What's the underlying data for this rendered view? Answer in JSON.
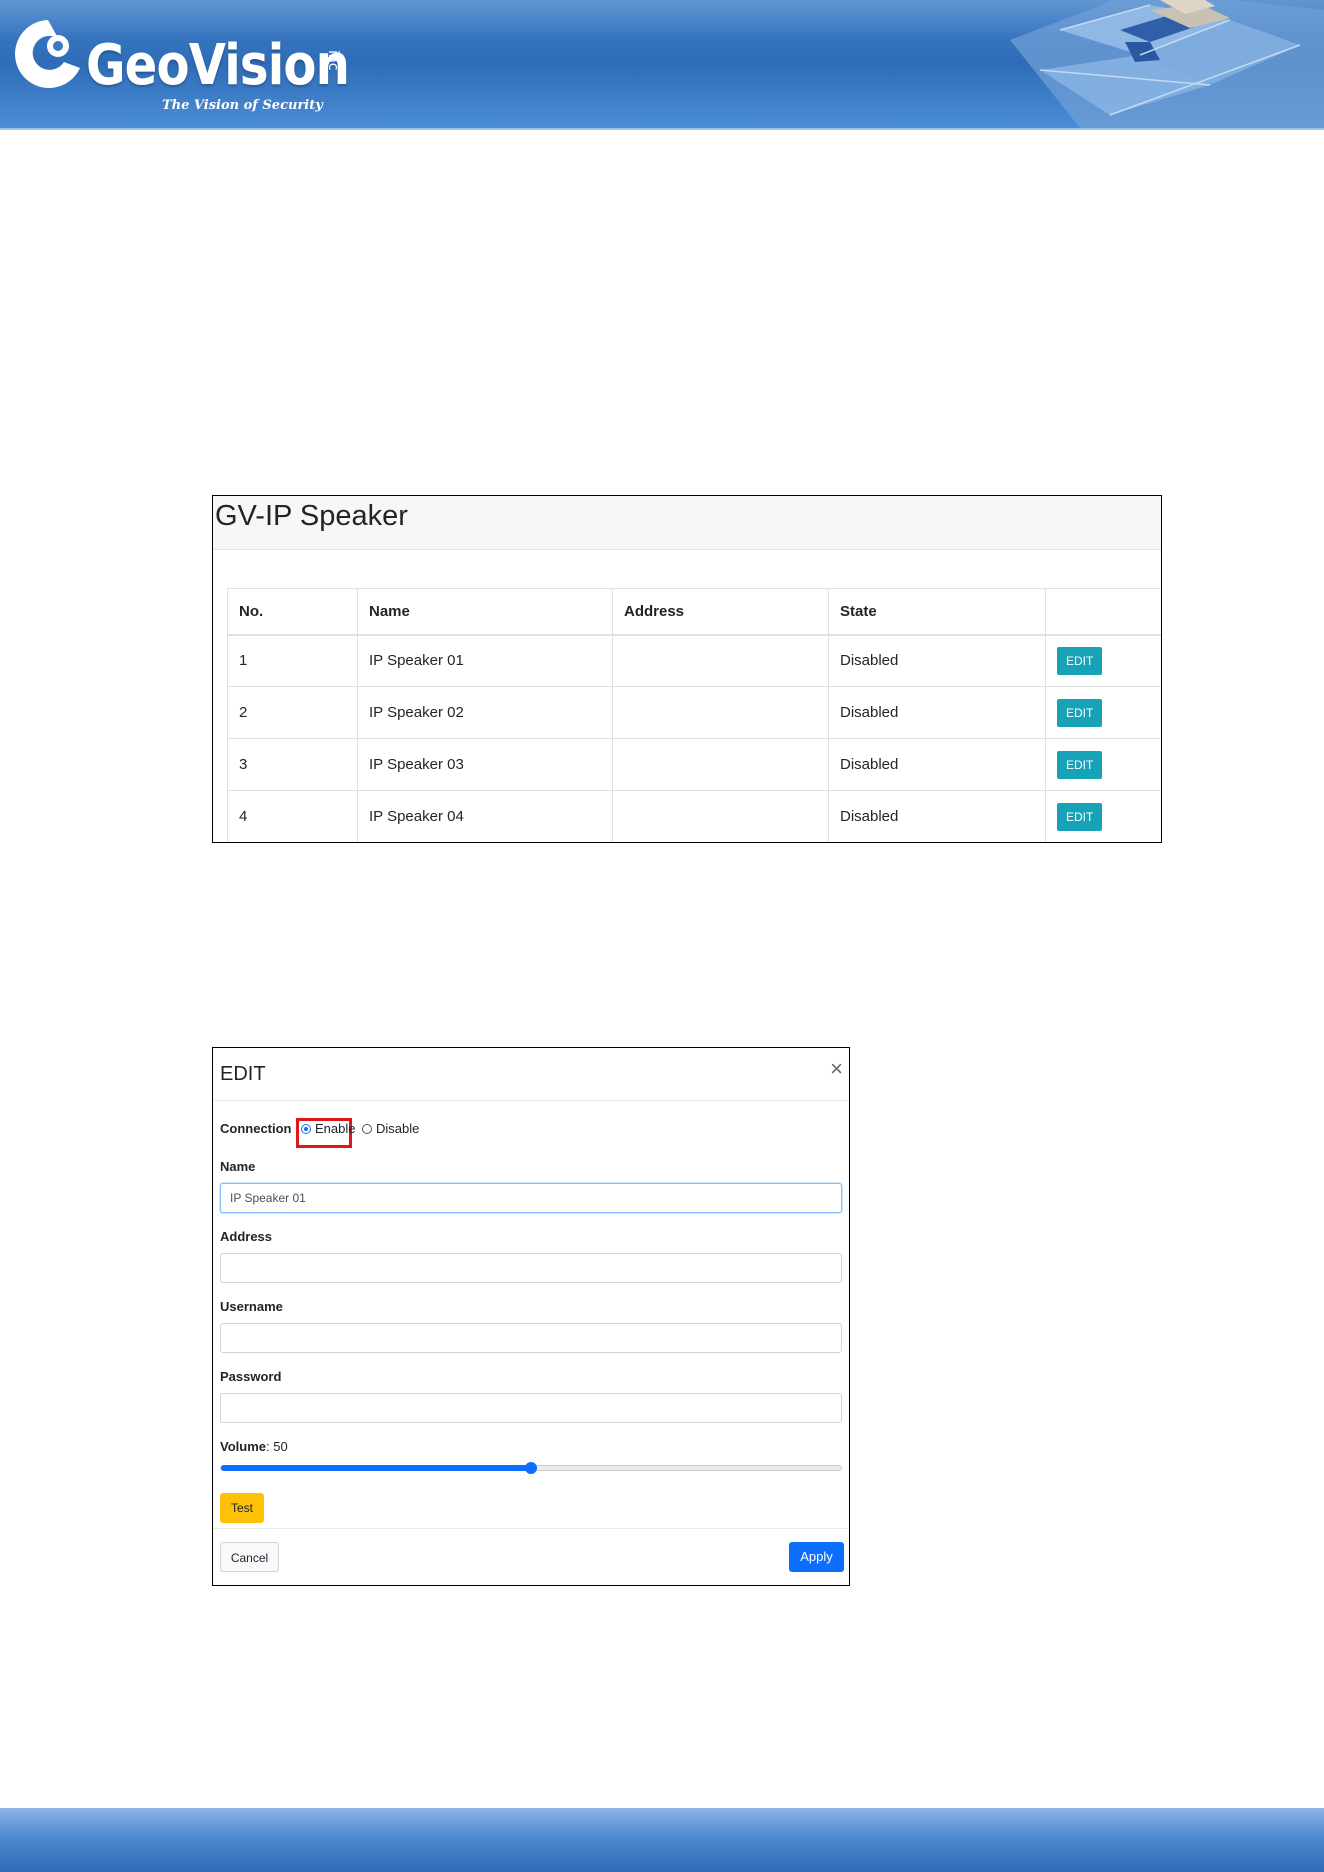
{
  "header": {
    "brand": "GeoVision",
    "brand_suffix": "inc",
    "tagline": "The Vision of Security"
  },
  "speaker_panel": {
    "title": "GV-IP Speaker",
    "columns": [
      "No.",
      "Name",
      "Address",
      "State",
      ""
    ],
    "rows": [
      {
        "no": "1",
        "name": "IP Speaker 01",
        "address": "",
        "state": "Disabled",
        "action": "EDIT"
      },
      {
        "no": "2",
        "name": "IP Speaker 02",
        "address": "",
        "state": "Disabled",
        "action": "EDIT"
      },
      {
        "no": "3",
        "name": "IP Speaker 03",
        "address": "",
        "state": "Disabled",
        "action": "EDIT"
      },
      {
        "no": "4",
        "name": "IP Speaker 04",
        "address": "",
        "state": "Disabled",
        "action": "EDIT"
      }
    ]
  },
  "edit_dialog": {
    "title": "EDIT",
    "close_symbol": "×",
    "connection_label": "Connection",
    "connection_options": [
      "Enable",
      "Disable"
    ],
    "connection_selected": "Enable",
    "name_label": "Name",
    "name_value": "IP Speaker 01",
    "address_label": "Address",
    "address_value": "",
    "username_label": "Username",
    "username_value": "",
    "password_label": "Password",
    "password_value": "",
    "volume_label": "Volume",
    "volume_value": "50",
    "volume_fraction": 0.5,
    "test_label": "Test",
    "cancel_label": "Cancel",
    "apply_label": "Apply"
  },
  "colors": {
    "edit_button": "#17a2b8",
    "apply_button": "#0d6efd",
    "test_button": "#ffc107",
    "highlight_box": "#e0161c"
  }
}
